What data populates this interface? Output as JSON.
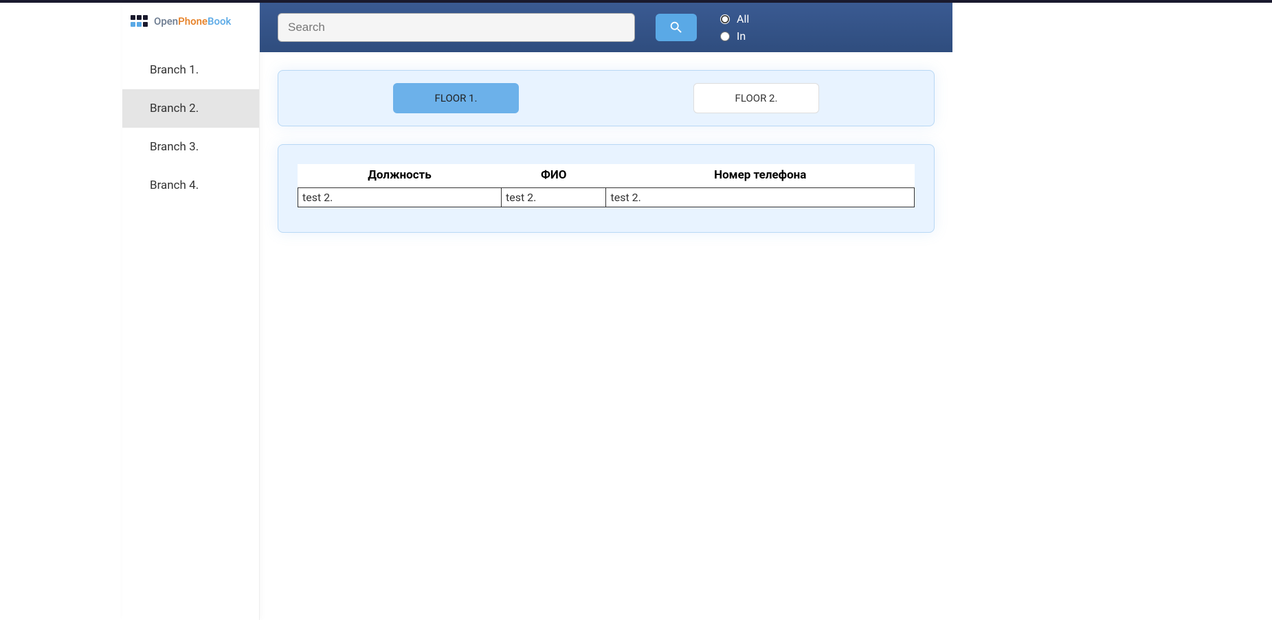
{
  "logo": {
    "part1": "Open",
    "part2": "Phone",
    "part3": "Book"
  },
  "sidebar": {
    "branches": [
      {
        "label": "Branch 1.",
        "active": false
      },
      {
        "label": "Branch 2.",
        "active": true
      },
      {
        "label": "Branch 3.",
        "active": false
      },
      {
        "label": "Branch 4.",
        "active": false
      }
    ]
  },
  "header": {
    "search_placeholder": "Search",
    "radio_all": "All",
    "radio_in": "In"
  },
  "floors": [
    {
      "label": "FLOOR 1.",
      "active": true
    },
    {
      "label": "FLOOR 2.",
      "active": false
    }
  ],
  "table": {
    "headers": {
      "position": "Должность",
      "name": "ФИО",
      "phone": "Номер телефона"
    },
    "rows": [
      {
        "position": "test 2.",
        "name": "test 2.",
        "phone": "test 2."
      }
    ]
  }
}
